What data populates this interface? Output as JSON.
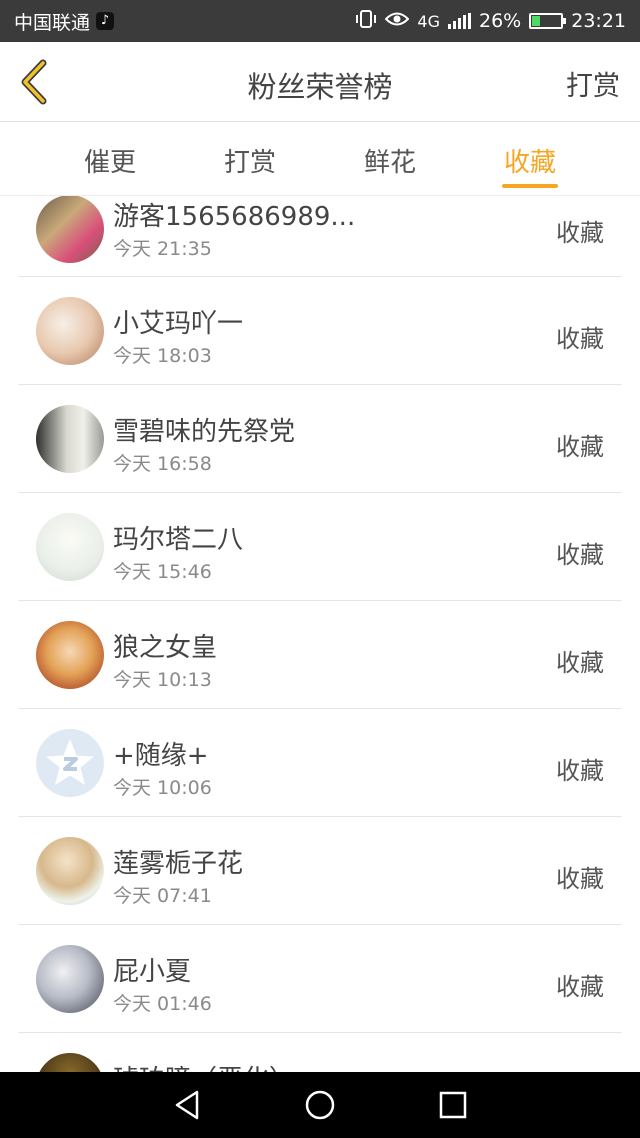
{
  "status_bar": {
    "carrier": "中国联通",
    "tiktok_glyph": "♪",
    "network": "4G",
    "battery": "26%",
    "time": "23:21"
  },
  "header": {
    "back_icon": "chevron-left-icon",
    "title": "粉丝荣誉榜",
    "action": "打赏",
    "accent_color": "#f5a623"
  },
  "tabs": [
    {
      "label": "催更",
      "active": false
    },
    {
      "label": "打赏",
      "active": false
    },
    {
      "label": "鲜花",
      "active": false
    },
    {
      "label": "收藏",
      "active": true
    }
  ],
  "list": [
    {
      "name": "游客1565686989...",
      "time": "今天 21:35",
      "action": "收藏"
    },
    {
      "name": "小艾玛吖一",
      "time": "今天 18:03",
      "action": "收藏"
    },
    {
      "name": "雪碧味的先祭党",
      "time": "今天 16:58",
      "action": "收藏"
    },
    {
      "name": "玛尔塔二八",
      "time": "今天 15:46",
      "action": "收藏"
    },
    {
      "name": "狼之女皇",
      "time": "今天 10:13",
      "action": "收藏"
    },
    {
      "name": "+随缘+",
      "time": "今天 10:06",
      "action": "收藏"
    },
    {
      "name": "莲雾栀子花",
      "time": "今天 07:41",
      "action": "收藏"
    },
    {
      "name": "屁小夏",
      "time": "今天 01:46",
      "action": "收藏"
    },
    {
      "name": "琥珀瞳（恶化）",
      "time": "",
      "action": ""
    }
  ]
}
